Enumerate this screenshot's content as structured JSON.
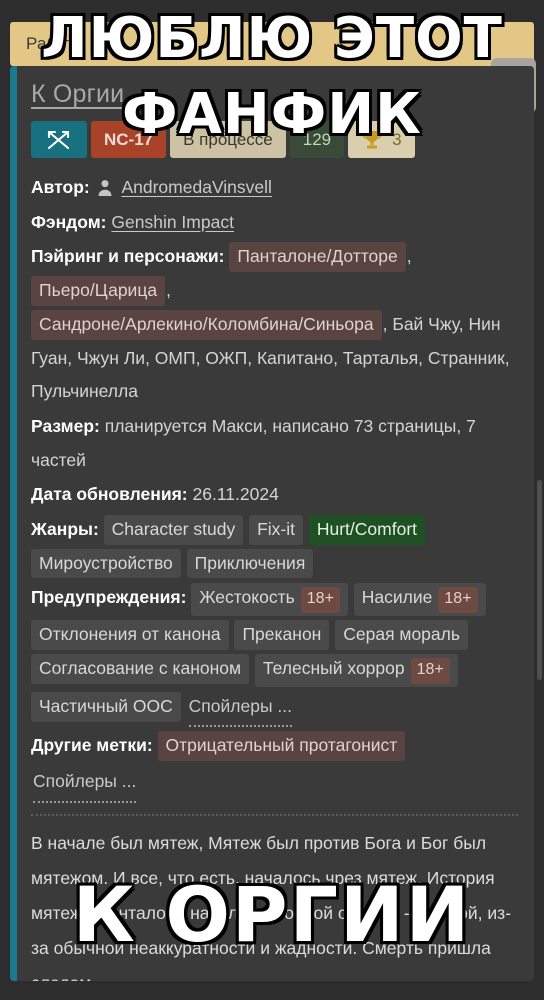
{
  "banner": {
    "text": "Работа"
  },
  "kebab": {
    "label": "more-options"
  },
  "fic": {
    "title": "К Оргии",
    "badges": {
      "direction_icon": "crossed-arrows-icon",
      "rating": "NC-17",
      "status": "В процессе",
      "likes": "129",
      "trophy_icon": "trophy-icon",
      "awards_count": "3"
    },
    "meta": {
      "author_label": "Автор:",
      "author_icon": "person-icon",
      "author": "AndromedaVinsvell",
      "fandom_label": "Фэндом:",
      "fandom": "Genshin Impact",
      "pairing_label": "Пэйринг и персонажи:",
      "pairing_tags": [
        "Панталоне/Дотторе",
        "Пьеро/Царица",
        "Сандроне/Арлекино/Коломбина/Синьора"
      ],
      "pairing_plain": "Бай Чжу, Нин Гуан, Чжун Ли, ОМП, ОЖП, Капитано, Тарталья, Странник, Пульчинелла",
      "size_label": "Размер:",
      "size": "планируется Макси, написано 73 страницы, 7 частей",
      "updated_label": "Дата обновления:",
      "updated": "26.11.2024",
      "genres_label": "Жанры:",
      "genres": [
        {
          "text": "Character study",
          "style": "plain"
        },
        {
          "text": "Fix-it",
          "style": "plain"
        },
        {
          "text": "Hurt/Comfort",
          "style": "green"
        },
        {
          "text": "Мироустройство",
          "style": "plain"
        },
        {
          "text": "Приключения",
          "style": "plain"
        }
      ],
      "warnings_label": "Предупреждения:",
      "warnings": [
        {
          "text": "Жестокость",
          "age": "18+"
        },
        {
          "text": "Насилие",
          "age": "18+"
        },
        {
          "text": "Отклонения от канона",
          "age": ""
        },
        {
          "text": "Преканон",
          "age": ""
        },
        {
          "text": "Серая мораль",
          "age": ""
        },
        {
          "text": "Согласование с каноном",
          "age": ""
        },
        {
          "text": "Телесный хоррор",
          "age": "18+"
        },
        {
          "text": "Частичный ООС",
          "age": ""
        }
      ],
      "warnings_spoiler": "Спойлеры ...",
      "other_label": "Другие метки:",
      "other_tags": [
        "Отрицательный протагонист"
      ],
      "other_spoiler": "Спойлеры ..."
    },
    "description": "В начале был мятеж, Мятеж был против Бога и Бог был мятежом. И все, что есть, началось чрез мятеж. История мятежа Панталоне началась с одной ошибки - детской, из-за обычной неаккуратности и жадности. Смерть пришла следом."
  },
  "meme_overlay": {
    "line1": "ЛЮБЛЮ ЭТОТ",
    "line2": "ФАНФИК",
    "line3": "К ОРГИИ"
  },
  "colors": {
    "banner_bg": "#e3c787",
    "card_bg": "#3a3a3a",
    "accent_teal": "#1d7a8c",
    "rating_red": "#a8432a",
    "green_tag": "#1f5024",
    "trophy_gold": "#c89a21"
  }
}
